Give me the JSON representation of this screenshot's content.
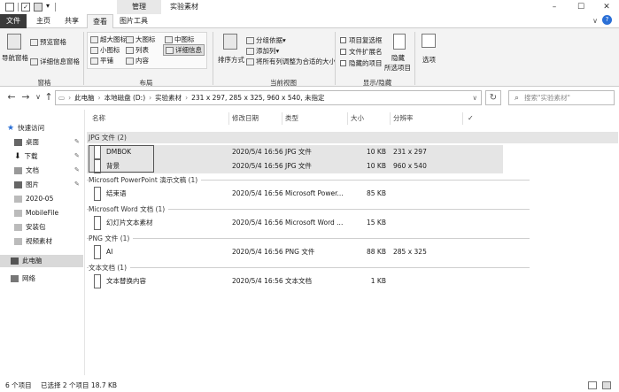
{
  "titlebar": {
    "context_tab": "管理",
    "title": "实验素材",
    "minimize": "–",
    "maximize": "☐",
    "close": "✕"
  },
  "tabs": [
    "文件",
    "主页",
    "共享",
    "查看",
    "图片工具"
  ],
  "ribbon": {
    "pane": {
      "nav_pane": "导航窗格",
      "preview_pane": "预览窗格",
      "details_pane": "详细信息窗格",
      "label": "窗格"
    },
    "layout": {
      "items": [
        "超大图标",
        "大图标",
        "中图标",
        "小图标",
        "列表",
        "详细信息",
        "平铺",
        "内容"
      ],
      "label": "布局"
    },
    "current_view": {
      "sort_by": "排序方式",
      "group_by": "分组依据",
      "add_column": "添加列",
      "size_columns": "将所有列调整为合适的大小",
      "label": "当前视图"
    },
    "show_hide": {
      "item_checkboxes": "项目复选框",
      "file_extensions": "文件扩展名",
      "hidden_items": "隐藏的项目",
      "hide_selected": "隐藏",
      "hide_selected_2": "所选项目",
      "options": "选项",
      "label": "显示/隐藏"
    }
  },
  "address": {
    "back": "←",
    "forward": "→",
    "dropdown": "∨",
    "up": "↑",
    "crumbs": [
      "此电脑",
      "本地磁盘 (D:)",
      "实验素材",
      "231 x 297, 285 x 325, 960 x 540, 未指定"
    ],
    "refresh": "↻",
    "search_placeholder": "搜索\"实验素材\""
  },
  "nav": {
    "quick_access": "快速访问",
    "items": [
      "桌面",
      "下载",
      "文档",
      "图片",
      "2020-05",
      "MobileFile",
      "安装包",
      "视频素材"
    ],
    "this_pc": "此电脑",
    "network": "网络"
  },
  "columns": {
    "name": "名称",
    "date": "修改日期",
    "type": "类型",
    "size": "大小",
    "resolution": "分辨率"
  },
  "groups": [
    {
      "header": "JPG 文件 (2)",
      "rows": [
        {
          "name": "DMBOK",
          "date": "2020/5/4 16:56",
          "type": "JPG 文件",
          "size": "10 KB",
          "resolution": "231 x 297",
          "selected": true
        },
        {
          "name": "背景",
          "date": "2020/5/4 16:56",
          "type": "JPG 文件",
          "size": "10 KB",
          "resolution": "960 x 540",
          "selected": true
        }
      ]
    },
    {
      "header": "Microsoft PowerPoint 演示文稿 (1)",
      "rows": [
        {
          "name": "结束语",
          "date": "2020/5/4 16:56",
          "type": "Microsoft Power...",
          "size": "85 KB",
          "resolution": ""
        }
      ]
    },
    {
      "header": "Microsoft Word 文档 (1)",
      "rows": [
        {
          "name": "幻灯片文本素材",
          "date": "2020/5/4 16:56",
          "type": "Microsoft Word ...",
          "size": "15 KB",
          "resolution": ""
        }
      ]
    },
    {
      "header": "PNG 文件 (1)",
      "rows": [
        {
          "name": "AI",
          "date": "2020/5/4 16:56",
          "type": "PNG 文件",
          "size": "88 KB",
          "resolution": "285 x 325"
        }
      ]
    },
    {
      "header": "文本文档 (1)",
      "rows": [
        {
          "name": "文本替换内容",
          "date": "2020/5/4 16:56",
          "type": "文本文档",
          "size": "1 KB",
          "resolution": ""
        }
      ]
    }
  ],
  "status": {
    "count": "6 个项目",
    "selection": "已选择 2 个项目  18.7 KB"
  }
}
